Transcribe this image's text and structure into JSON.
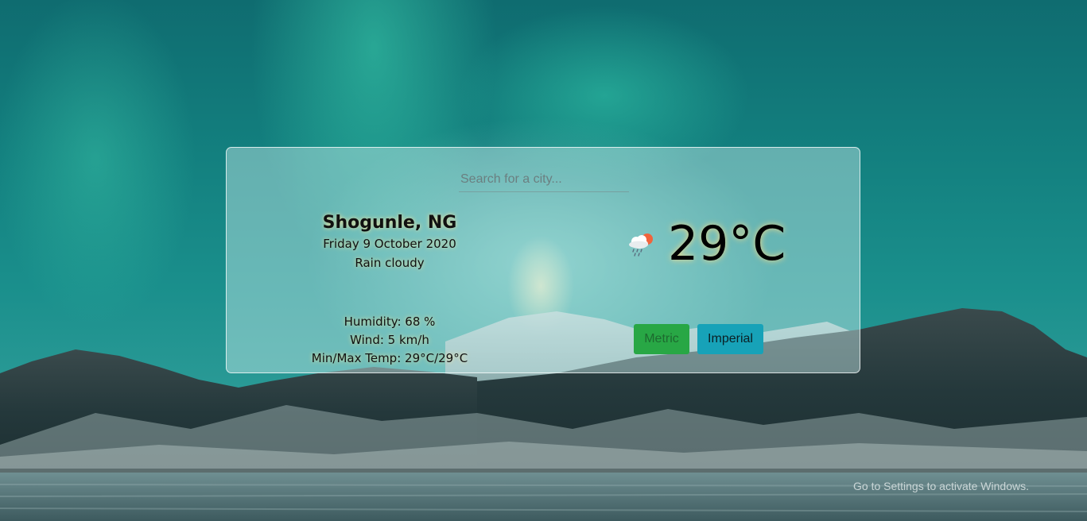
{
  "search": {
    "placeholder": "Search for a city..."
  },
  "location": {
    "city": "Shogunle, NG",
    "date": "Friday 9 October 2020",
    "description": "Rain cloudy"
  },
  "weather": {
    "icon": "rain-cloud-sun-icon",
    "temperature": "29°C"
  },
  "stats": {
    "humidity": "Humidity: 68 %",
    "wind": "Wind: 5 km/h",
    "minmax": "Min/Max Temp: 29°C/29°C"
  },
  "units": {
    "metric_label": "Metric",
    "imperial_label": "Imperial"
  },
  "overlay": {
    "watermark": "Go to Settings to activate Windows."
  },
  "colors": {
    "metric_button": "#28a745",
    "imperial_button": "#17a2b8"
  }
}
